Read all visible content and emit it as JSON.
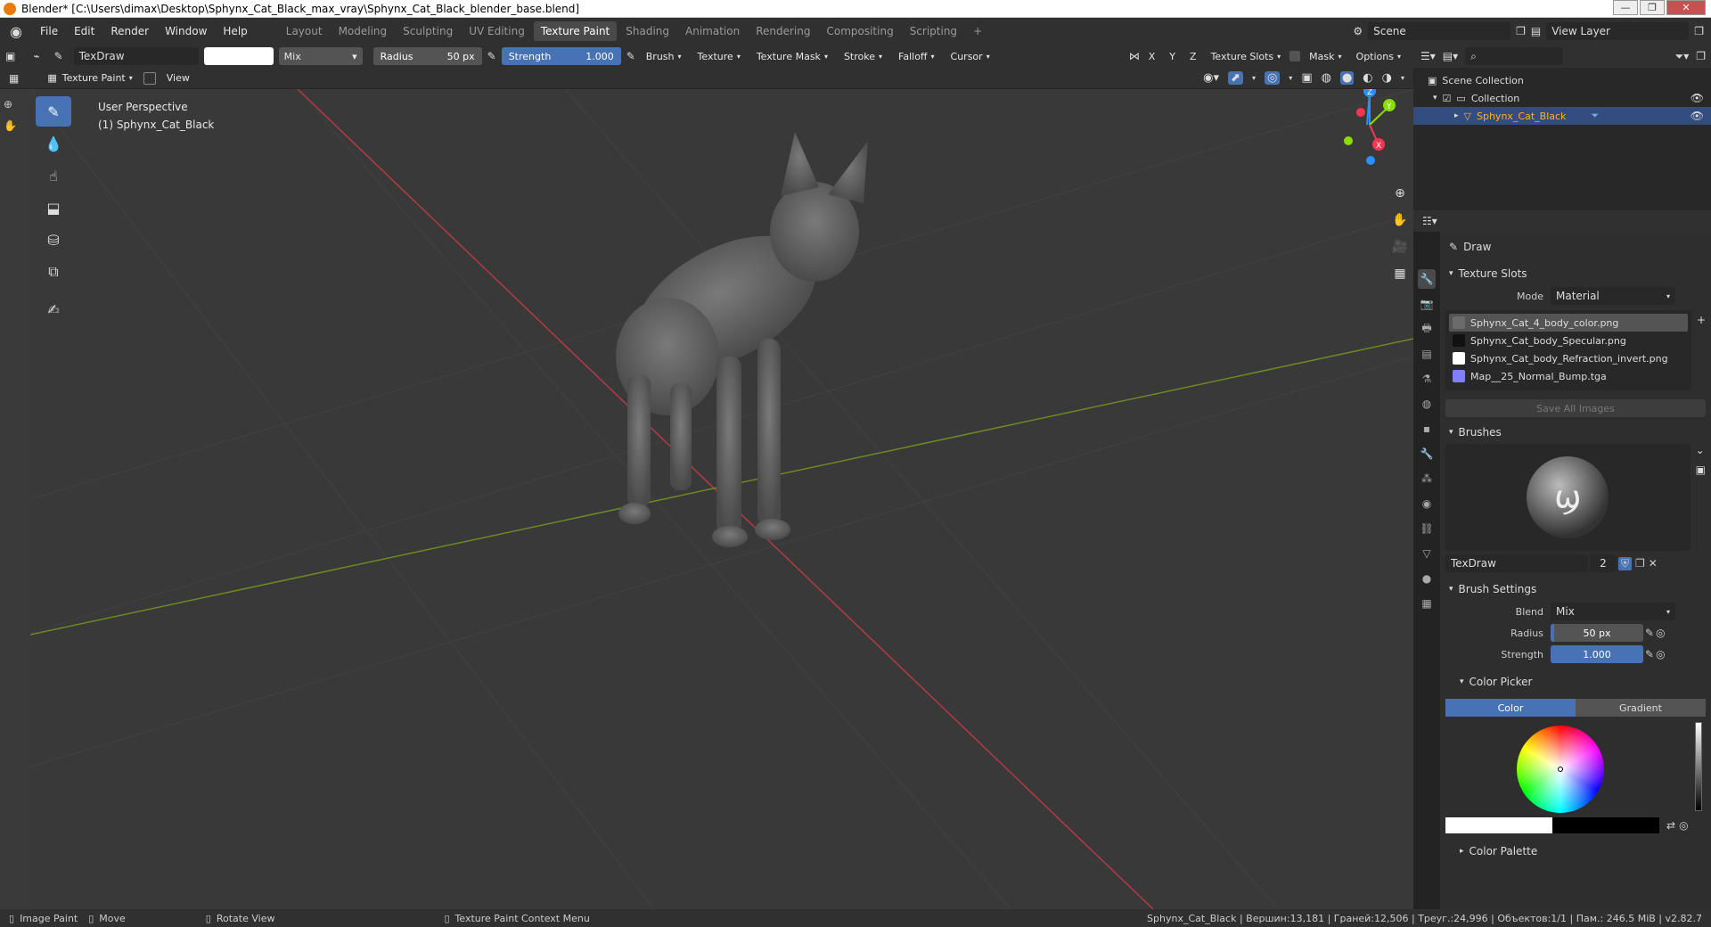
{
  "window": {
    "title": "Blender* [C:\\Users\\dimax\\Desktop\\Sphynx_Cat_Black_max_vray\\Sphynx_Cat_Black_blender_base.blend]",
    "minimize": "—",
    "maximize": "❐",
    "close": "✕"
  },
  "menu": [
    "File",
    "Edit",
    "Render",
    "Window",
    "Help"
  ],
  "workspaces": [
    "Layout",
    "Modeling",
    "Sculpting",
    "UV Editing",
    "Texture Paint",
    "Shading",
    "Animation",
    "Rendering",
    "Compositing",
    "Scripting"
  ],
  "active_workspace": "Texture Paint",
  "scene": {
    "name": "Scene",
    "view_layer": "View Layer"
  },
  "tool_header": {
    "brush_name": "TexDraw",
    "blend": "Mix",
    "radius_label": "Radius",
    "radius_value": "50 px",
    "strength_label": "Strength",
    "strength_value": "1.000",
    "menus": [
      "Brush",
      "Texture",
      "Texture Mask",
      "Stroke",
      "Falloff",
      "Cursor"
    ],
    "axes": [
      "X",
      "Y",
      "Z"
    ],
    "texture_slots": "Texture Slots",
    "mask": "Mask",
    "options": "Options"
  },
  "view_header": {
    "mode": "Texture Paint",
    "view": "View"
  },
  "viewport": {
    "perspective": "User Perspective",
    "object": "(1) Sphynx_Cat_Black"
  },
  "gizmo": {
    "x": "X",
    "y": "Y",
    "z": "Z"
  },
  "outliner": {
    "root": "Scene Collection",
    "collection": "Collection",
    "object": "Sphynx_Cat_Black"
  },
  "properties": {
    "tool_name": "Draw",
    "texture_slots": {
      "title": "Texture Slots",
      "mode_label": "Mode",
      "mode_value": "Material",
      "slots": [
        {
          "name": "Sphynx_Cat_4_body_color.png",
          "color": "#6b6b6b"
        },
        {
          "name": "Sphynx_Cat_body_Specular.png",
          "color": "#111111"
        },
        {
          "name": "Sphynx_Cat_body_Refraction_invert.png",
          "color": "#ffffff"
        },
        {
          "name": "Map__25_Normal_Bump.tga",
          "color": "#8080ff"
        }
      ],
      "save_all": "Save All Images"
    },
    "brushes": {
      "title": "Brushes",
      "name": "TexDraw",
      "users": "2"
    },
    "brush_settings": {
      "title": "Brush Settings",
      "blend_label": "Blend",
      "blend_value": "Mix",
      "radius_label": "Radius",
      "radius_value": "50 px",
      "strength_label": "Strength",
      "strength_value": "1.000",
      "color_picker": "Color Picker",
      "tab_color": "Color",
      "tab_gradient": "Gradient",
      "color_palette": "Color Palette"
    }
  },
  "status": {
    "image_paint": "Image Paint",
    "move": "Move",
    "rotate": "Rotate View",
    "context": "Texture Paint Context Menu",
    "stats": "Sphynx_Cat_Black | Вершин:13,181 | Граней:12,506 | Треуг.:24,996 | Объектов:1/1 | Пам.: 246.5 MiB | v2.82.7"
  },
  "colors": {
    "accent": "#4772b3",
    "selected_object": "#ffaf29",
    "x_axis": "#ff3352",
    "y_axis": "#8bdc00",
    "z_axis": "#2890ff"
  }
}
